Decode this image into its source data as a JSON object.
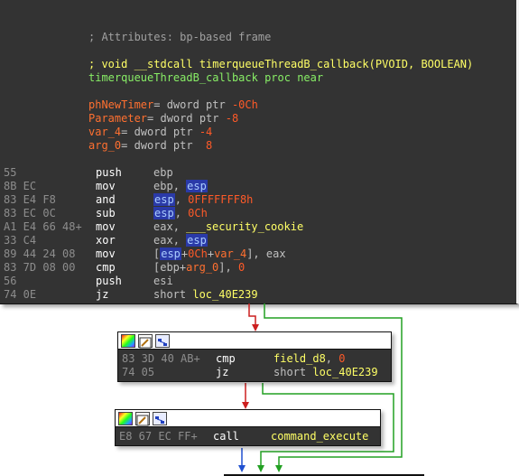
{
  "main": {
    "comment_attr": "; Attributes: bp-based frame",
    "proto": "; void __stdcall timerqueueThreadB_callback(PVOID, BOOLEAN)",
    "proc_line": "timerqueueThreadB_callback proc near",
    "vars": [
      {
        "name": "phNewTimer",
        "mid": "= dword ptr ",
        "off": "-0Ch"
      },
      {
        "name": "Parameter",
        "mid": "= dword ptr ",
        "off": "-8"
      },
      {
        "name": "var_4",
        "mid": "= dword ptr ",
        "off": "-4"
      },
      {
        "name": "arg_0",
        "mid": "= dword ptr  ",
        "off": "8"
      }
    ],
    "instr": [
      {
        "bytes": "55",
        "mn": "push",
        "ops": "ebp"
      },
      {
        "bytes": "8B EC",
        "mn": "mov",
        "ops": "ebp, esp"
      },
      {
        "bytes": "83 E4 F8",
        "mn": "and",
        "ops": "esp, 0FFFFFFF8h"
      },
      {
        "bytes": "83 EC 0C",
        "mn": "sub",
        "ops": "esp, 0Ch"
      },
      {
        "bytes": "A1 E4 66 48+",
        "mn": "mov",
        "ops": "eax, ___security_cookie"
      },
      {
        "bytes": "33 C4",
        "mn": "xor",
        "ops": "eax, esp"
      },
      {
        "bytes": "89 44 24 08",
        "mn": "mov",
        "ops": "[esp+0Ch+var_4], eax"
      },
      {
        "bytes": "83 7D 08 00",
        "mn": "cmp",
        "ops": "[ebp+arg_0], 0"
      },
      {
        "bytes": "56",
        "mn": "push",
        "ops": "esi"
      },
      {
        "bytes": "74 0E",
        "mn": "jz",
        "ops": "short loc_40E239"
      }
    ],
    "tok": {
      "ebp": "ebp",
      "esp": "esp",
      "comma": ", ",
      "mask": "0FFFFFFF8h",
      "c0c": "0Ch",
      "eax": "eax",
      "cookie": "___security_cookie",
      "lb": "[",
      "plus": "+",
      "var4": "var_4",
      "rb": "], ",
      "arg0": "arg_0",
      "zero": "0",
      "esi": "esi",
      "short": "short ",
      "loc": "loc_40E239"
    }
  },
  "block2": {
    "rows": [
      {
        "bytes": "83 3D 40 AB+",
        "mn": "cmp",
        "op1": "field_d8",
        "sep": ", ",
        "op2": "0"
      },
      {
        "bytes": "74 05",
        "mn": "jz",
        "op1": "short ",
        "op2": "loc_40E239"
      }
    ]
  },
  "block3": {
    "rows": [
      {
        "bytes": "E8 67 EC FF+",
        "mn": "call",
        "op1": "command_execute"
      }
    ]
  },
  "colors": {
    "edge_false": "#cc1f1f",
    "edge_true": "#22a022",
    "edge_next": "#2050d0"
  }
}
